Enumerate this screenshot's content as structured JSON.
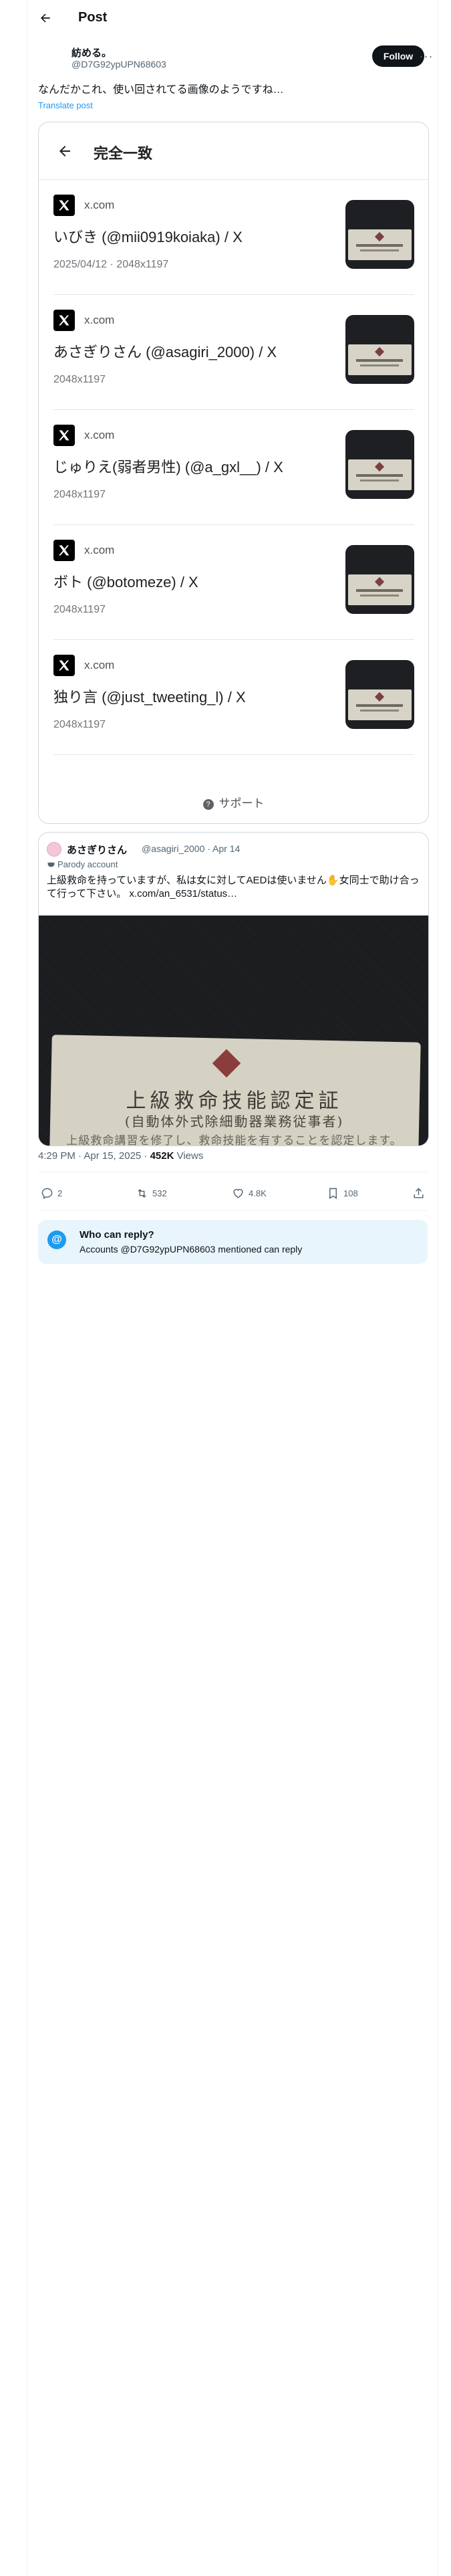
{
  "header": {
    "title": "Post"
  },
  "author": {
    "name": "紡める。",
    "handle": "@D7G92ypUPN68603",
    "follow_label": "Follow",
    "more": "···"
  },
  "post": {
    "text": "なんだかこれ、使い回されてる画像のようですね…",
    "translate": "Translate post"
  },
  "shot": {
    "title": "完全一致",
    "results": [
      {
        "site": "x.com",
        "title": "いびき (@mii0919koiaka) / X",
        "meta": "2025/04/12 · 2048x1197"
      },
      {
        "site": "x.com",
        "title": "あさぎりさん (@asagiri_2000) / X",
        "meta": "2048x1197"
      },
      {
        "site": "x.com",
        "title": "じゅりえ(弱者男性) (@a_gxl__) / X",
        "meta": "2048x1197"
      },
      {
        "site": "x.com",
        "title": "ボト (@botomeze) / X",
        "meta": "2048x1197"
      },
      {
        "site": "x.com",
        "title": "独り言 (@just_tweeting_l) / X",
        "meta": "2048x1197"
      }
    ],
    "support": "サポート"
  },
  "quote": {
    "name": "あさぎりさん",
    "handle": "@asagiri_2000 · Apr 14",
    "parody": "Parody account",
    "text": "上級救命を持っていますが、私は女に対してAEDは使いません✋女同士で助け合って行って下さい。 x.com/an_6531/status…",
    "card_title": "上級救命技能認定証",
    "card_sub": "(自動体外式除細動器業務従事者)",
    "card_bottom": "上級救命講習を修了し、救命技能を有することを認定します。"
  },
  "meta": {
    "time": "4:29 PM · Apr 15, 2025 · ",
    "views_count": "452K",
    "views_label": " Views"
  },
  "actions": {
    "replies": "2",
    "reposts": "532",
    "likes": "4.8K",
    "bookmarks": "108"
  },
  "reply_box": {
    "title": "Who can reply?",
    "desc": "Accounts @D7G92ypUPN68603 mentioned can reply"
  },
  "colors": {
    "accent": "#1d9bf0",
    "text": "#0f1419",
    "muted": "#536471"
  }
}
